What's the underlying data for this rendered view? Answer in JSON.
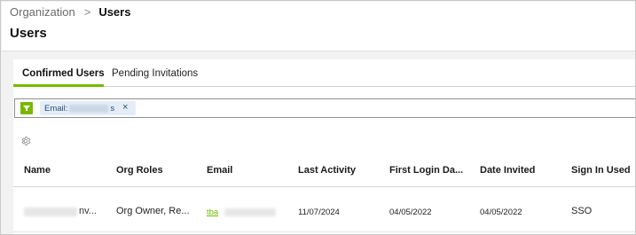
{
  "breadcrumb": {
    "parent": "Organization",
    "separator": ">",
    "current": "Users"
  },
  "page": {
    "title": "Users"
  },
  "tabs": [
    {
      "label": "Confirmed Users",
      "active": true
    },
    {
      "label": "Pending Invitations",
      "active": false
    }
  ],
  "filter": {
    "chip_prefix": "Email:",
    "chip_suffix": "s",
    "chip_close": "×"
  },
  "table": {
    "columns": [
      "Name",
      "Org Roles",
      "Email",
      "Last Activity",
      "First Login Da...",
      "Date Invited",
      "Sign In Used"
    ],
    "rows": [
      {
        "name_suffix": "nv...",
        "org_roles": "Org Owner, Re...",
        "email_visible": "tba",
        "last_activity": "11/07/2024",
        "first_login": "04/05/2022",
        "date_invited": "04/05/2022",
        "sign_in_used": "SSO"
      }
    ]
  },
  "colors": {
    "accent": "#76b900",
    "chip_bg": "#e4edf7",
    "chip_text": "#1f4f7a"
  },
  "icons": {
    "filter": "filter-funnel-icon",
    "settings": "gear-icon",
    "breadcrumb_separator": "chevron-right-icon",
    "chip_remove": "close-icon"
  }
}
